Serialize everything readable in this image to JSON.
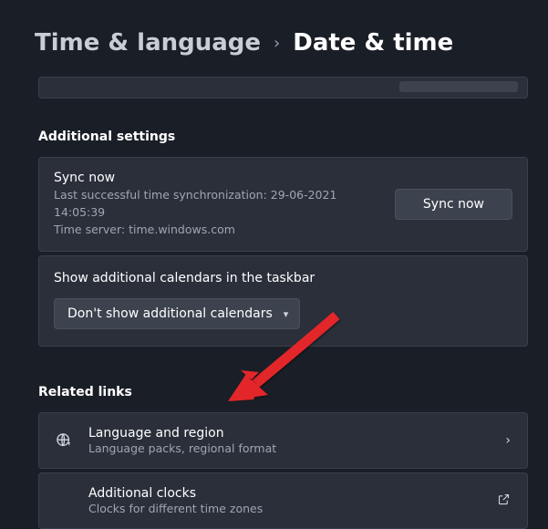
{
  "breadcrumb": {
    "parent": "Time & language",
    "current": "Date & time"
  },
  "sections": {
    "additional_settings": "Additional settings",
    "related_links": "Related links"
  },
  "sync": {
    "title": "Sync now",
    "last_sync": "Last successful time synchronization: 29-06-2021 14:05:39",
    "server": "Time server: time.windows.com",
    "button": "Sync now"
  },
  "calendars": {
    "label": "Show additional calendars in the taskbar",
    "selected": "Don't show additional calendars"
  },
  "links": {
    "language": {
      "title": "Language and region",
      "sub": "Language packs, regional format"
    },
    "clocks": {
      "title": "Additional clocks",
      "sub": "Clocks for different time zones"
    }
  }
}
